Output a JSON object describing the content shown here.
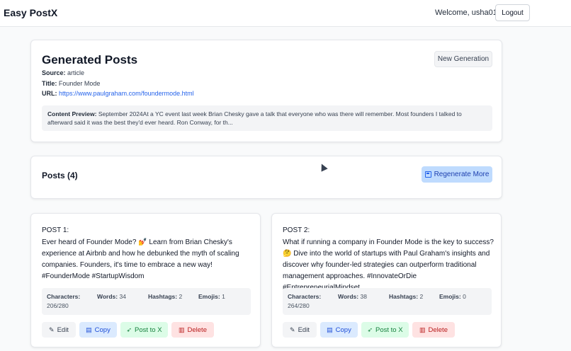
{
  "nav": {
    "brand": "Easy PostX",
    "welcome": "Welcome, usha01",
    "logout": "Logout"
  },
  "generated": {
    "title": "Generated Posts",
    "new_generation": "New Generation",
    "source_label": "Source:",
    "source": "article",
    "title_label": "Title:",
    "article_title": "Founder Mode",
    "url_label": "URL:",
    "url": "https://www.paulgraham.com/foundermode.html",
    "preview_label": "Content Preview:",
    "preview": "September 2024At a YC event last week Brian Chesky gave a talk that everyone who was there will remember. Most founders I talked to afterward said it was the best they'd ever heard. Ron Conway, for th..."
  },
  "posts_header": {
    "title": "Posts (4)",
    "regenerate": "Regenerate More"
  },
  "labels": {
    "characters": "Characters:",
    "words": "Words:",
    "hashtags": "Hashtags:",
    "emojis": "Emojis:",
    "edit": "Edit",
    "copy": "Copy",
    "post_to_x": "Post to X",
    "delete": "Delete"
  },
  "posts": [
    {
      "label": "POST 1:",
      "text": "Ever heard of Founder Mode? 💅 Learn from Brian Chesky's experience at Airbnb and how he debunked the myth of scaling companies. Founders, it's time to embrace a new way! #FounderMode #StartupWisdom",
      "words": "34",
      "hashtags": "2",
      "emojis": "1",
      "chars": "206/280"
    },
    {
      "label": "POST 2:",
      "text": "What if running a company in Founder Mode is the key to success? 🤔 Dive into the world of startups with Paul Graham's insights and discover why founder-led strategies can outperform traditional management approaches. #InnovateOrDie #EntrepreneurialMindset",
      "words": "38",
      "hashtags": "2",
      "emojis": "0",
      "chars": "264/280"
    }
  ],
  "icons": {
    "edit": "pencil-icon",
    "copy": "clipboard-icon",
    "post": "send-icon",
    "delete": "trash-icon",
    "regenerate": "save-icon"
  },
  "colors": {
    "accent": "#2563eb",
    "copy_bg": "#dbeafe",
    "post_bg": "#dcfce7",
    "delete_bg": "#fee2e2"
  }
}
